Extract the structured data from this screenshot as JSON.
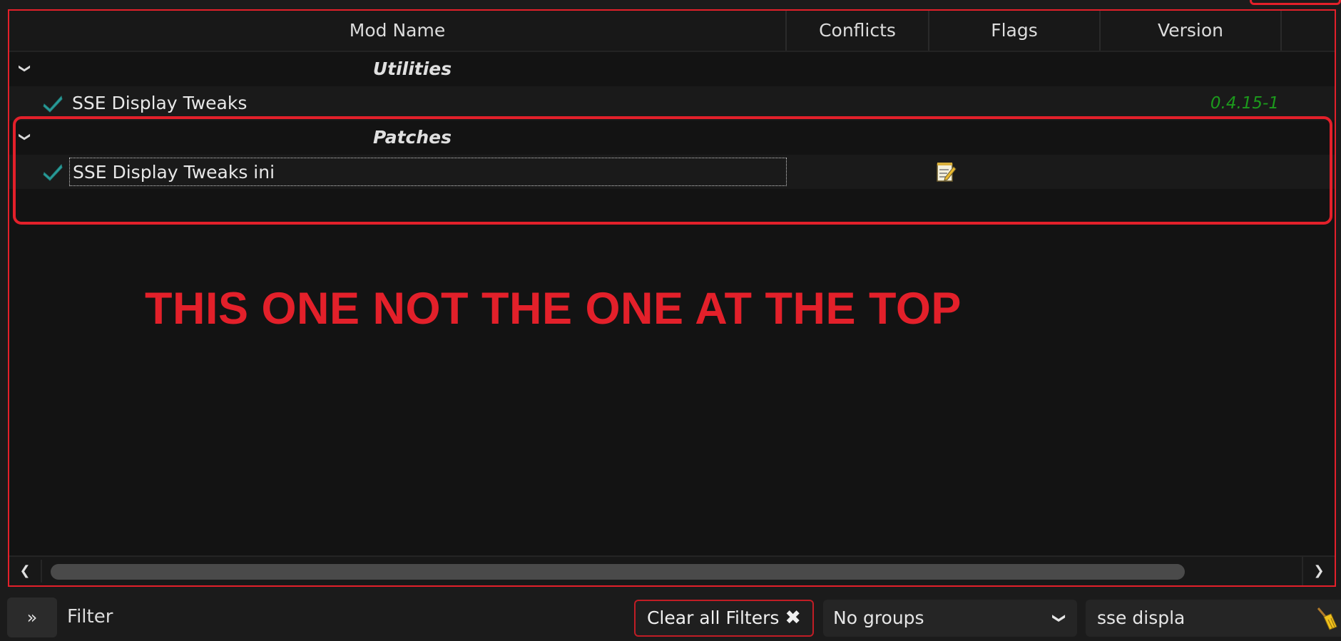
{
  "table": {
    "columns": [
      "Mod Name",
      "Conflicts",
      "Flags",
      "Version"
    ],
    "groups": [
      {
        "label": "Utilities",
        "mods": [
          {
            "name": "SSE Display Tweaks",
            "enabled": true,
            "version": "0.4.15-1",
            "flag_icon": ""
          }
        ]
      },
      {
        "label": "Patches",
        "mods": [
          {
            "name": "SSE Display Tweaks ini",
            "enabled": true,
            "version": "",
            "flag_icon": "notes-icon"
          }
        ]
      }
    ]
  },
  "annotation": "THIS ONE NOT THE ONE AT THE TOP",
  "bottom_bar": {
    "expand_label": "»",
    "filter_label": "Filter",
    "clear_filters_label": "Clear all Filters",
    "clear_icon": "✖",
    "groups_select_value": "No groups",
    "search_value": "sse displa"
  },
  "colors": {
    "accent_red": "#e3202a",
    "version_green": "#1c9a1c",
    "check_teal": "#2a9d9a"
  }
}
